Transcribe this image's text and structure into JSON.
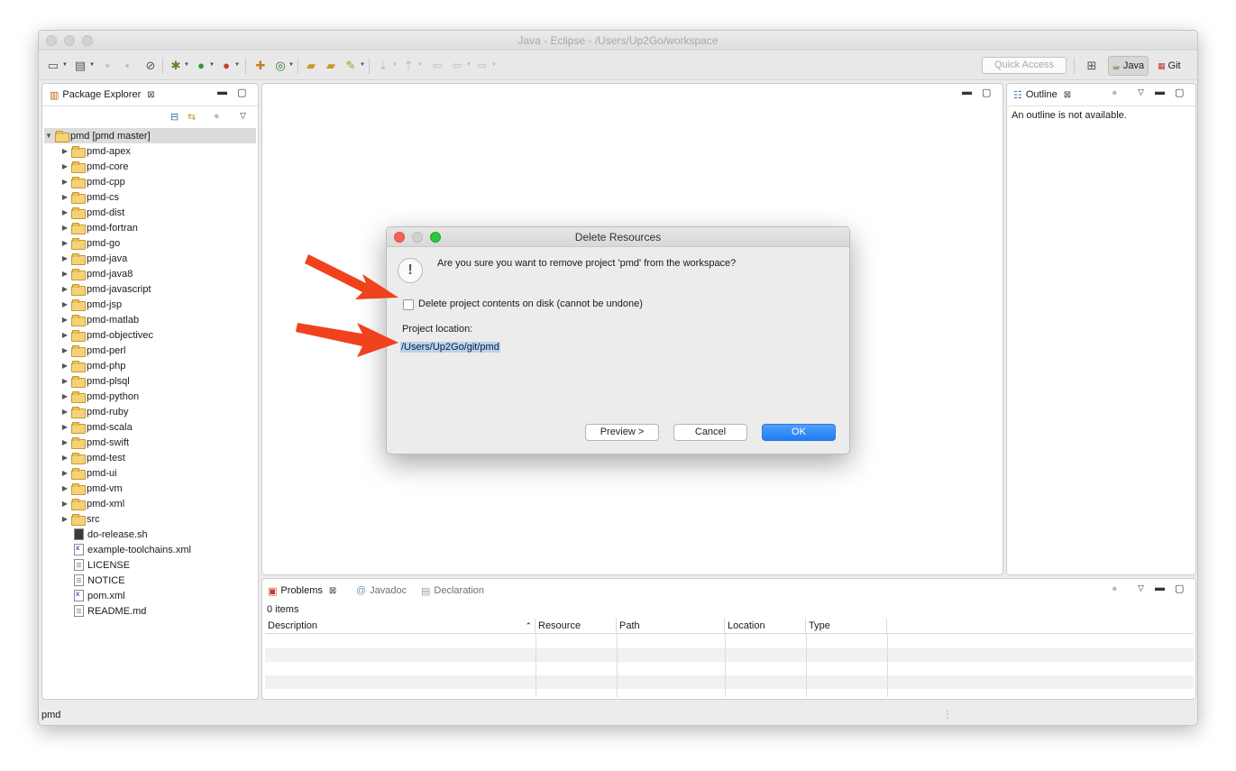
{
  "window": {
    "title": "Java - Eclipse - /Users/Up2Go/workspace"
  },
  "toolbar": {
    "quick_access_placeholder": "Quick Access",
    "perspectives": [
      {
        "label": "Java",
        "active": true
      },
      {
        "label": "Git",
        "active": false
      }
    ]
  },
  "package_explorer": {
    "tab_label": "Package Explorer",
    "root": {
      "label": "pmd  [pmd master]"
    },
    "folders": [
      "pmd-apex",
      "pmd-core",
      "pmd-cpp",
      "pmd-cs",
      "pmd-dist",
      "pmd-fortran",
      "pmd-go",
      "pmd-java",
      "pmd-java8",
      "pmd-javascript",
      "pmd-jsp",
      "pmd-matlab",
      "pmd-objectivec",
      "pmd-perl",
      "pmd-php",
      "pmd-plsql",
      "pmd-python",
      "pmd-ruby",
      "pmd-scala",
      "pmd-swift",
      "pmd-test",
      "pmd-ui",
      "pmd-vm",
      "pmd-xml",
      "src"
    ],
    "files": [
      {
        "label": "do-release.sh",
        "icon": "shell-script-icon"
      },
      {
        "label": "example-toolchains.xml",
        "icon": "xml-file-icon"
      },
      {
        "label": "LICENSE",
        "icon": "text-file-icon"
      },
      {
        "label": "NOTICE",
        "icon": "text-file-icon"
      },
      {
        "label": "pom.xml",
        "icon": "maven-file-icon"
      },
      {
        "label": "README.md",
        "icon": "text-file-icon"
      }
    ]
  },
  "outline": {
    "tab_label": "Outline",
    "message": "An outline is not available."
  },
  "bottom_panel": {
    "tabs": [
      {
        "label": "Problems",
        "active": true
      },
      {
        "label": "Javadoc",
        "active": false
      },
      {
        "label": "Declaration",
        "active": false
      }
    ],
    "items_count": "0 items",
    "columns": [
      "Description",
      "Resource",
      "Path",
      "Location",
      "Type"
    ]
  },
  "status_bar": {
    "text": "pmd"
  },
  "dialog": {
    "title": "Delete Resources",
    "question": "Are you sure you want to remove project 'pmd' from the workspace?",
    "checkbox_label": "Delete project contents on disk (cannot be undone)",
    "checkbox_checked": false,
    "location_label": "Project location:",
    "location_value": "/Users/Up2Go/git/pmd",
    "buttons": {
      "preview": "Preview >",
      "cancel": "Cancel",
      "ok": "OK"
    }
  },
  "colors": {
    "accent_button": "#1f7cf2",
    "annotation_arrow": "#f0421c",
    "selection": "#b3d3f5"
  }
}
